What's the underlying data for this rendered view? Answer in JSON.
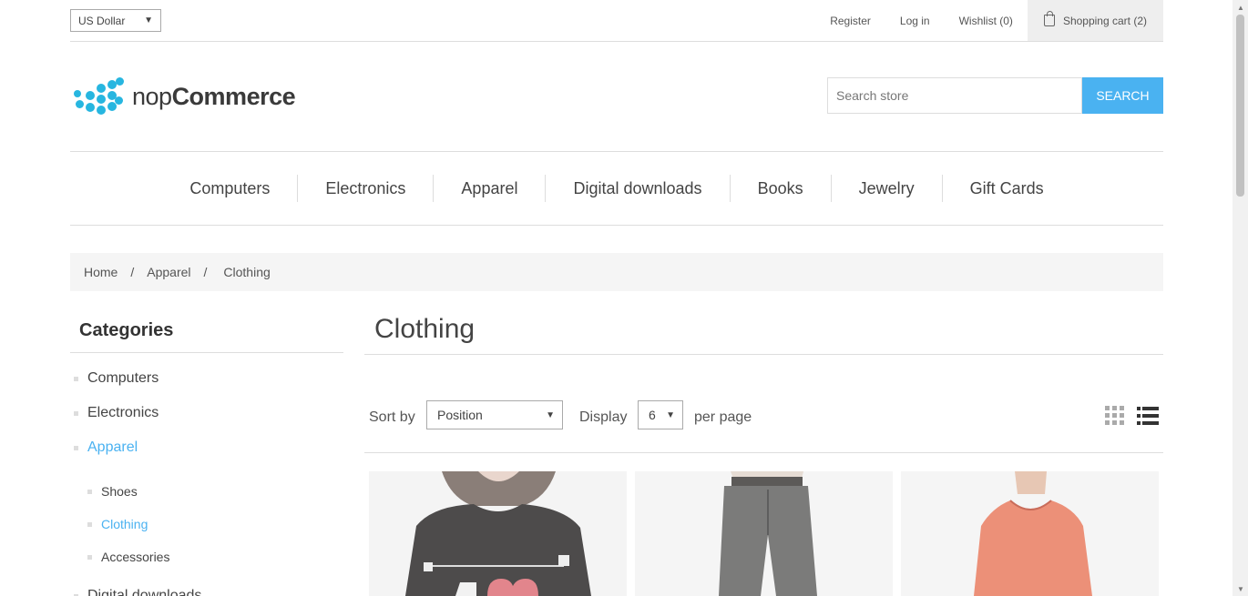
{
  "header": {
    "currency": "US Dollar",
    "links": {
      "register": "Register",
      "login": "Log in",
      "wishlist": "Wishlist (0)",
      "cart": "Shopping cart (2)"
    }
  },
  "logo": {
    "text_light": "nop",
    "text_bold": "Commerce"
  },
  "search": {
    "placeholder": "Search store",
    "button": "SEARCH"
  },
  "menu": [
    "Computers",
    "Electronics",
    "Apparel",
    "Digital downloads",
    "Books",
    "Jewelry",
    "Gift Cards"
  ],
  "breadcrumb": {
    "home": "Home",
    "sep": "/",
    "parent": "Apparel",
    "current": "Clothing"
  },
  "sidebar": {
    "title": "Categories",
    "items": [
      "Computers",
      "Electronics",
      "Apparel"
    ],
    "subitems": [
      "Shoes",
      "Clothing",
      "Accessories"
    ],
    "next_item": "Digital downloads"
  },
  "main": {
    "title": "Clothing",
    "sort_label": "Sort by",
    "sort_value": "Position",
    "display_label": "Display",
    "display_value": "6",
    "per_page": "per page"
  },
  "colors": {
    "accent": "#4ab2f1",
    "logo": "#27b6e0"
  }
}
